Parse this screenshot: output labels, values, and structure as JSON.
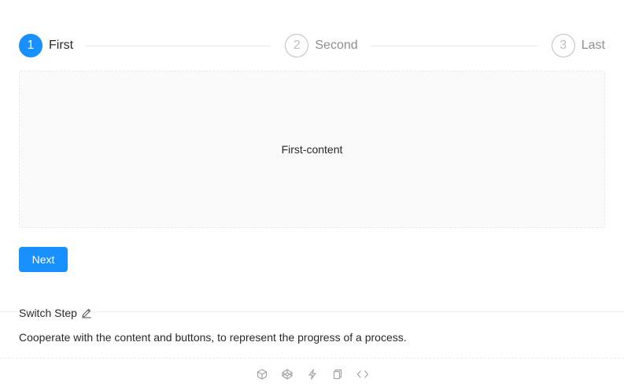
{
  "steps": [
    {
      "number": "1",
      "title": "First",
      "status": "process"
    },
    {
      "number": "2",
      "title": "Second",
      "status": "wait"
    },
    {
      "number": "3",
      "title": "Last",
      "status": "wait"
    }
  ],
  "content": {
    "text": "First-content"
  },
  "buttons": {
    "next_label": "Next"
  },
  "meta": {
    "title": "Switch Step",
    "description": "Cooperate with the content and buttons, to represent the progress of a process."
  },
  "actions": {
    "icons": [
      "codesandbox-icon",
      "codepen-icon",
      "thunderbolt-icon",
      "copy-icon",
      "code-icon"
    ]
  },
  "colors": {
    "primary": "#1890ff",
    "content_bg": "#fafafa",
    "border": "#e9e9e9"
  }
}
